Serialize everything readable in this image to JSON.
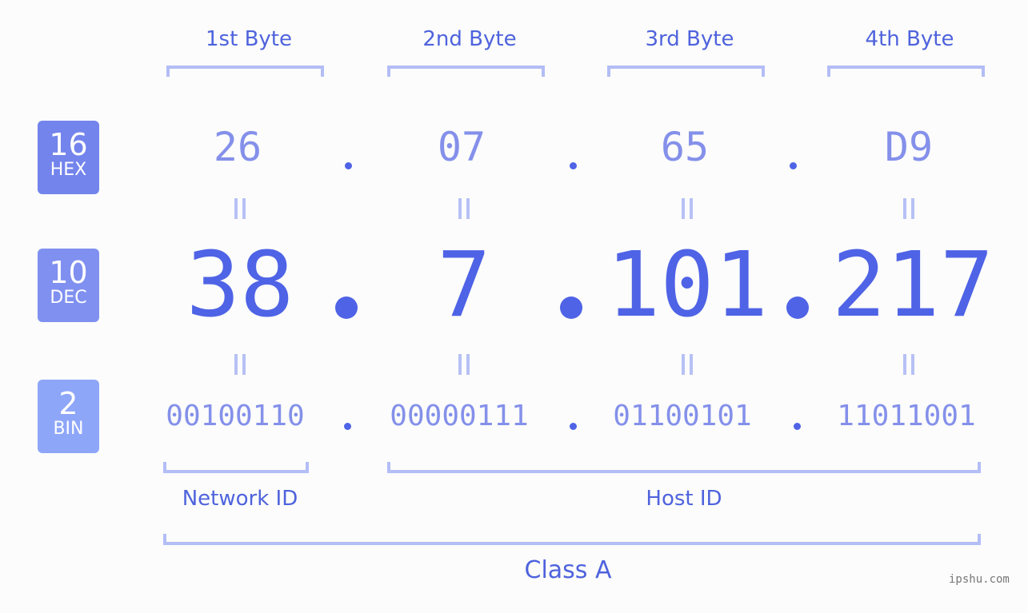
{
  "bytes": [
    {
      "label": "1st Byte",
      "hex": "26",
      "dec": "38",
      "bin": "00100110"
    },
    {
      "label": "2nd Byte",
      "hex": "07",
      "dec": "7",
      "bin": "00000111"
    },
    {
      "label": "3rd Byte",
      "hex": "65",
      "dec": "101",
      "bin": "01100101"
    },
    {
      "label": "4th Byte",
      "hex": "D9",
      "dec": "217",
      "bin": "11011001"
    }
  ],
  "badges": {
    "hex": {
      "num": "16",
      "label": "HEX",
      "color": "#7384ec"
    },
    "dec": {
      "num": "10",
      "label": "DEC",
      "color": "#8090f0"
    },
    "bin": {
      "num": "2",
      "label": "BIN",
      "color": "#8ea6f8"
    }
  },
  "labels": {
    "network_id": "Network ID",
    "host_id": "Host ID",
    "class": "Class A"
  },
  "watermark": "ipshu.com"
}
